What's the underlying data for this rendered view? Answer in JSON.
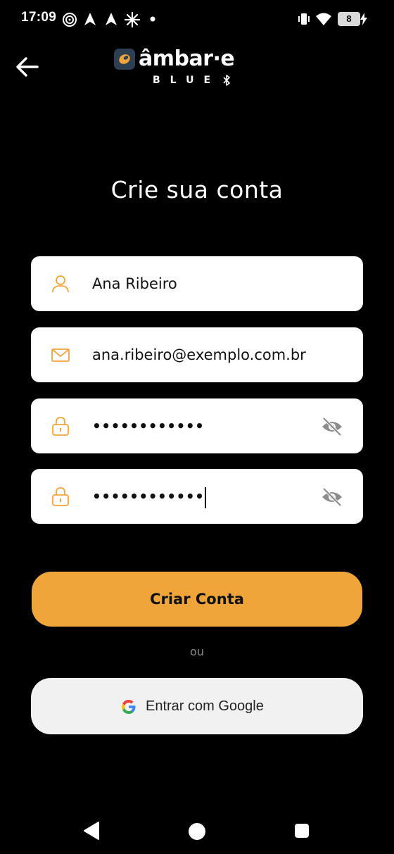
{
  "status_bar": {
    "time": "17:09",
    "battery": "8",
    "icons": [
      "target-icon",
      "navigation-icon",
      "navigation-icon",
      "sparkle-icon",
      "dot-icon",
      "vibrate-icon",
      "wifi-icon",
      "battery-icon",
      "charging-icon"
    ]
  },
  "header": {
    "back_icon": "arrow-left-icon",
    "logo_text": "âmbar·e",
    "logo_sub": "BLUE"
  },
  "page": {
    "title": "Crie sua conta"
  },
  "form": {
    "name_value": "Ana Ribeiro",
    "email_value": "ana.ribeiro@exemplo.com.br",
    "password_value": "••••••••••••",
    "confirm_password_value": "••••••••••••"
  },
  "actions": {
    "create_account_label": "Criar Conta",
    "or_label": "ou",
    "google_label": "Entrar com Google"
  },
  "colors": {
    "accent": "#f0a53a",
    "background": "#000000",
    "field_bg": "#ffffff",
    "google_bg": "#f1f1f1",
    "logo_mark": "#2e3f52"
  }
}
